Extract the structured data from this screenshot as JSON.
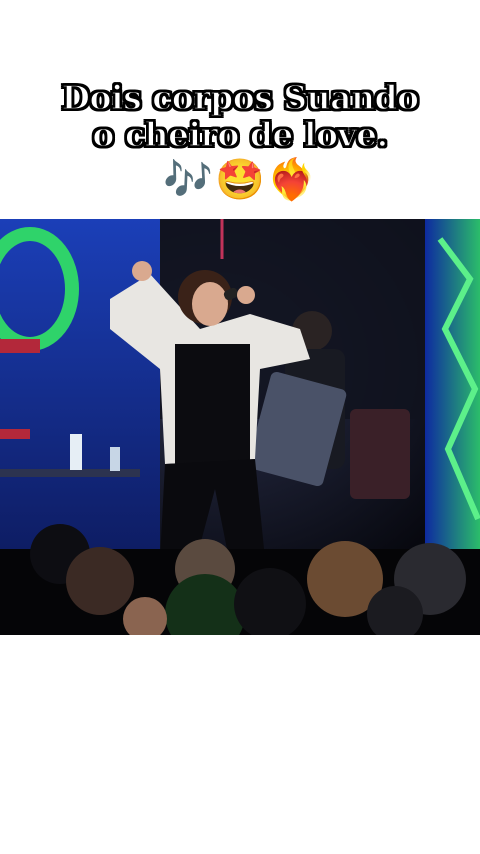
{
  "caption": {
    "line1": "Dois corpos Suando",
    "line2": "o cheiro de love.",
    "emojis": {
      "notes": "🎶",
      "star_face": "🤩",
      "fire_heart": "❤️‍🔥"
    }
  },
  "colors": {
    "background": "#ffffff",
    "caption_text": "#ffffff",
    "caption_outline": "#000000",
    "stage_blue": "#1f4fd1",
    "stage_green": "#2fd36a"
  },
  "icons": [
    "musical-notes-icon",
    "star-struck-face-icon",
    "heart-on-fire-icon"
  ]
}
